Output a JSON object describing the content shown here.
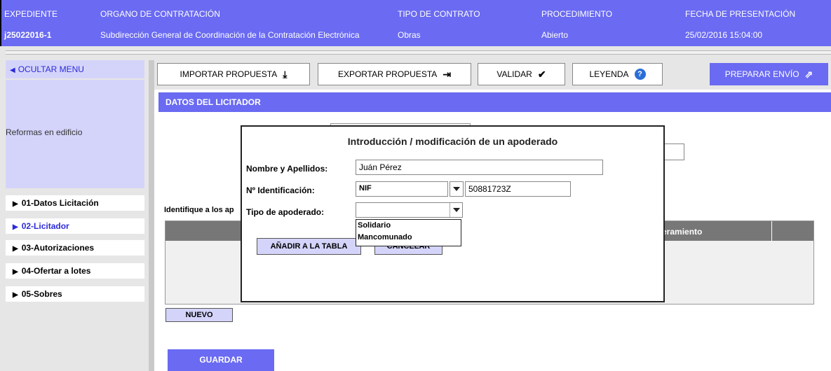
{
  "header": {
    "expediente_label": "EXPEDIENTE",
    "expediente_value": "j25022016-1",
    "organo_label": "ORGANO DE CONTRATACIÓN",
    "organo_value": "Subdirección General de Coordinación de la Contratación Electrónica",
    "tipo_label": "TIPO DE CONTRATO",
    "tipo_value": "Obras",
    "procedimiento_label": "PROCEDIMIENTO",
    "procedimiento_value": "Abierto",
    "fecha_label": "FECHA DE PRESENTACIÓN",
    "fecha_value": "25/02/2016 15:04:00"
  },
  "sidebar": {
    "ocultar_label": "OCULTAR MENU",
    "description": "Reformas en edificio",
    "items": [
      {
        "label": "01-Datos Licitación",
        "active": false
      },
      {
        "label": "02-Licitador",
        "active": true
      },
      {
        "label": "03-Autorizaciones",
        "active": false
      },
      {
        "label": "04-Ofertar a lotes",
        "active": false
      },
      {
        "label": "05-Sobres",
        "active": false
      }
    ]
  },
  "toolbar": {
    "importar": "IMPORTAR PROPUESTA",
    "exportar": "EXPORTAR PROPUESTA",
    "validar": "VALIDAR",
    "leyenda": "LEYENDA",
    "preparar": "PREPARAR ENVÍO"
  },
  "main": {
    "section_title": "DATOS DEL LICITADOR",
    "identifique_text": "Identifique a los ap",
    "table_header_partial": "eramiento",
    "nuevo_label": "NUEVO",
    "guardar_label": "GUARDAR"
  },
  "modal": {
    "title": "Introducción / modificación de un apoderado",
    "nombre_label": "Nombre y Apellidos:",
    "nombre_value": "Juán Pérez",
    "id_label": "Nº Identificación:",
    "id_type": "NIF",
    "id_value": "50881723Z",
    "tipo_label": "Tipo de apoderado:",
    "tipo_value": "",
    "tipo_options": [
      "Solidario",
      "Mancomunado"
    ],
    "anadir_label": "AÑADIR A LA TABLA",
    "cancelar_label": "CANCELAR"
  },
  "colors": {
    "header_bg": "#6a6af2",
    "sidebar_light": "#d4d4fb",
    "link_blue": "#2b2bd8"
  }
}
